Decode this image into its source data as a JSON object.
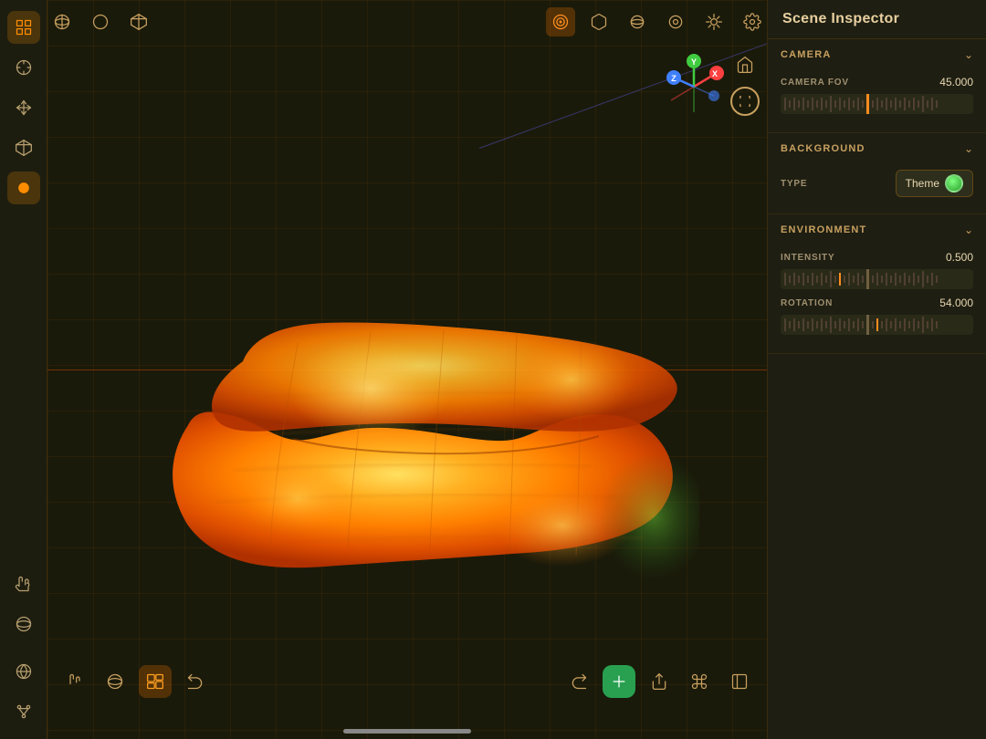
{
  "app": {
    "title": "Scene Inspector"
  },
  "leftToolbar": {
    "icons": [
      {
        "name": "grid-icon",
        "label": "Grid",
        "active": true
      },
      {
        "name": "select-icon",
        "label": "Select",
        "active": false
      },
      {
        "name": "transform-icon",
        "label": "Transform",
        "active": false
      },
      {
        "name": "box-icon",
        "label": "Box",
        "active": false
      },
      {
        "name": "orange-shape-icon",
        "label": "Shape",
        "active": true,
        "accent": true
      },
      {
        "name": "hand-icon",
        "label": "Hand",
        "bottom": true
      },
      {
        "name": "rotate-icon",
        "label": "Rotate",
        "bottom": true
      },
      {
        "name": "pivot-icon",
        "label": "Pivot",
        "bottom": true
      },
      {
        "name": "world-icon",
        "label": "World",
        "bottom": true
      },
      {
        "name": "branch-icon",
        "label": "Branch",
        "bottom": true
      }
    ]
  },
  "topToolbar": {
    "icons": [
      {
        "name": "sphere-wire-icon",
        "label": "Sphere Wire"
      },
      {
        "name": "sphere-solid-icon",
        "label": "Sphere Solid"
      },
      {
        "name": "cube-wire-icon",
        "label": "Cube Wire"
      },
      {
        "name": "settings-icon",
        "label": "Settings"
      },
      {
        "name": "target-icon",
        "label": "Target",
        "accent": true
      },
      {
        "name": "cube-icon",
        "label": "Cube"
      },
      {
        "name": "sphere-icon",
        "label": "Sphere"
      },
      {
        "name": "torus-icon",
        "label": "Torus"
      },
      {
        "name": "settings2-icon",
        "label": "Settings 2"
      }
    ]
  },
  "inspector": {
    "title": "Scene Inspector",
    "sections": {
      "camera": {
        "label": "CAMERA",
        "expanded": true,
        "properties": {
          "fov": {
            "label": "CAMERA FOV",
            "value": "45.000"
          }
        }
      },
      "background": {
        "label": "BACKGROUND",
        "expanded": true,
        "properties": {
          "type": {
            "label": "TYPE",
            "value": "Theme"
          }
        }
      },
      "environment": {
        "label": "ENVIRONMENT",
        "expanded": true,
        "properties": {
          "intensity": {
            "label": "INTENSITY",
            "value": "0.500"
          },
          "rotation": {
            "label": "ROTATION",
            "value": "54.000"
          }
        }
      }
    }
  },
  "bottomToolbar": {
    "left": [
      {
        "name": "hand-tool-icon",
        "label": "Hand"
      },
      {
        "name": "orbit-icon",
        "label": "Orbit"
      },
      {
        "name": "frame-icon",
        "label": "Frame"
      },
      {
        "name": "frame2-icon",
        "label": "Frame 2"
      }
    ],
    "right": [
      {
        "name": "share-icon",
        "label": "Share"
      },
      {
        "name": "command-icon",
        "label": "Command"
      },
      {
        "name": "add-icon",
        "label": "Add",
        "green": true
      },
      {
        "name": "panels-icon",
        "label": "Panels"
      }
    ]
  },
  "sliders": {
    "fov": {
      "ticks": [
        2,
        1,
        2,
        1,
        2,
        1,
        2,
        1,
        2,
        1,
        3,
        1,
        2,
        1,
        2,
        1,
        2,
        1,
        4,
        1,
        2,
        1,
        2,
        1,
        2,
        1,
        2,
        1,
        2,
        1,
        3,
        1,
        2,
        1
      ],
      "accentIndex": 18
    },
    "intensity": {
      "ticks": [
        2,
        1,
        2,
        1,
        2,
        1,
        2,
        1,
        2,
        1,
        3,
        1,
        2,
        1,
        2,
        1,
        2,
        1,
        4,
        1,
        2,
        1,
        2,
        1,
        2,
        1,
        2,
        1,
        2,
        1
      ],
      "accentIndex": 12
    },
    "rotation": {
      "ticks": [
        2,
        1,
        2,
        1,
        2,
        1,
        2,
        1,
        2,
        1,
        3,
        1,
        2,
        1,
        2,
        1,
        2,
        1,
        4,
        1,
        2,
        1,
        2,
        1,
        2,
        1,
        2,
        1,
        2,
        1
      ],
      "accentIndex": 20
    }
  }
}
